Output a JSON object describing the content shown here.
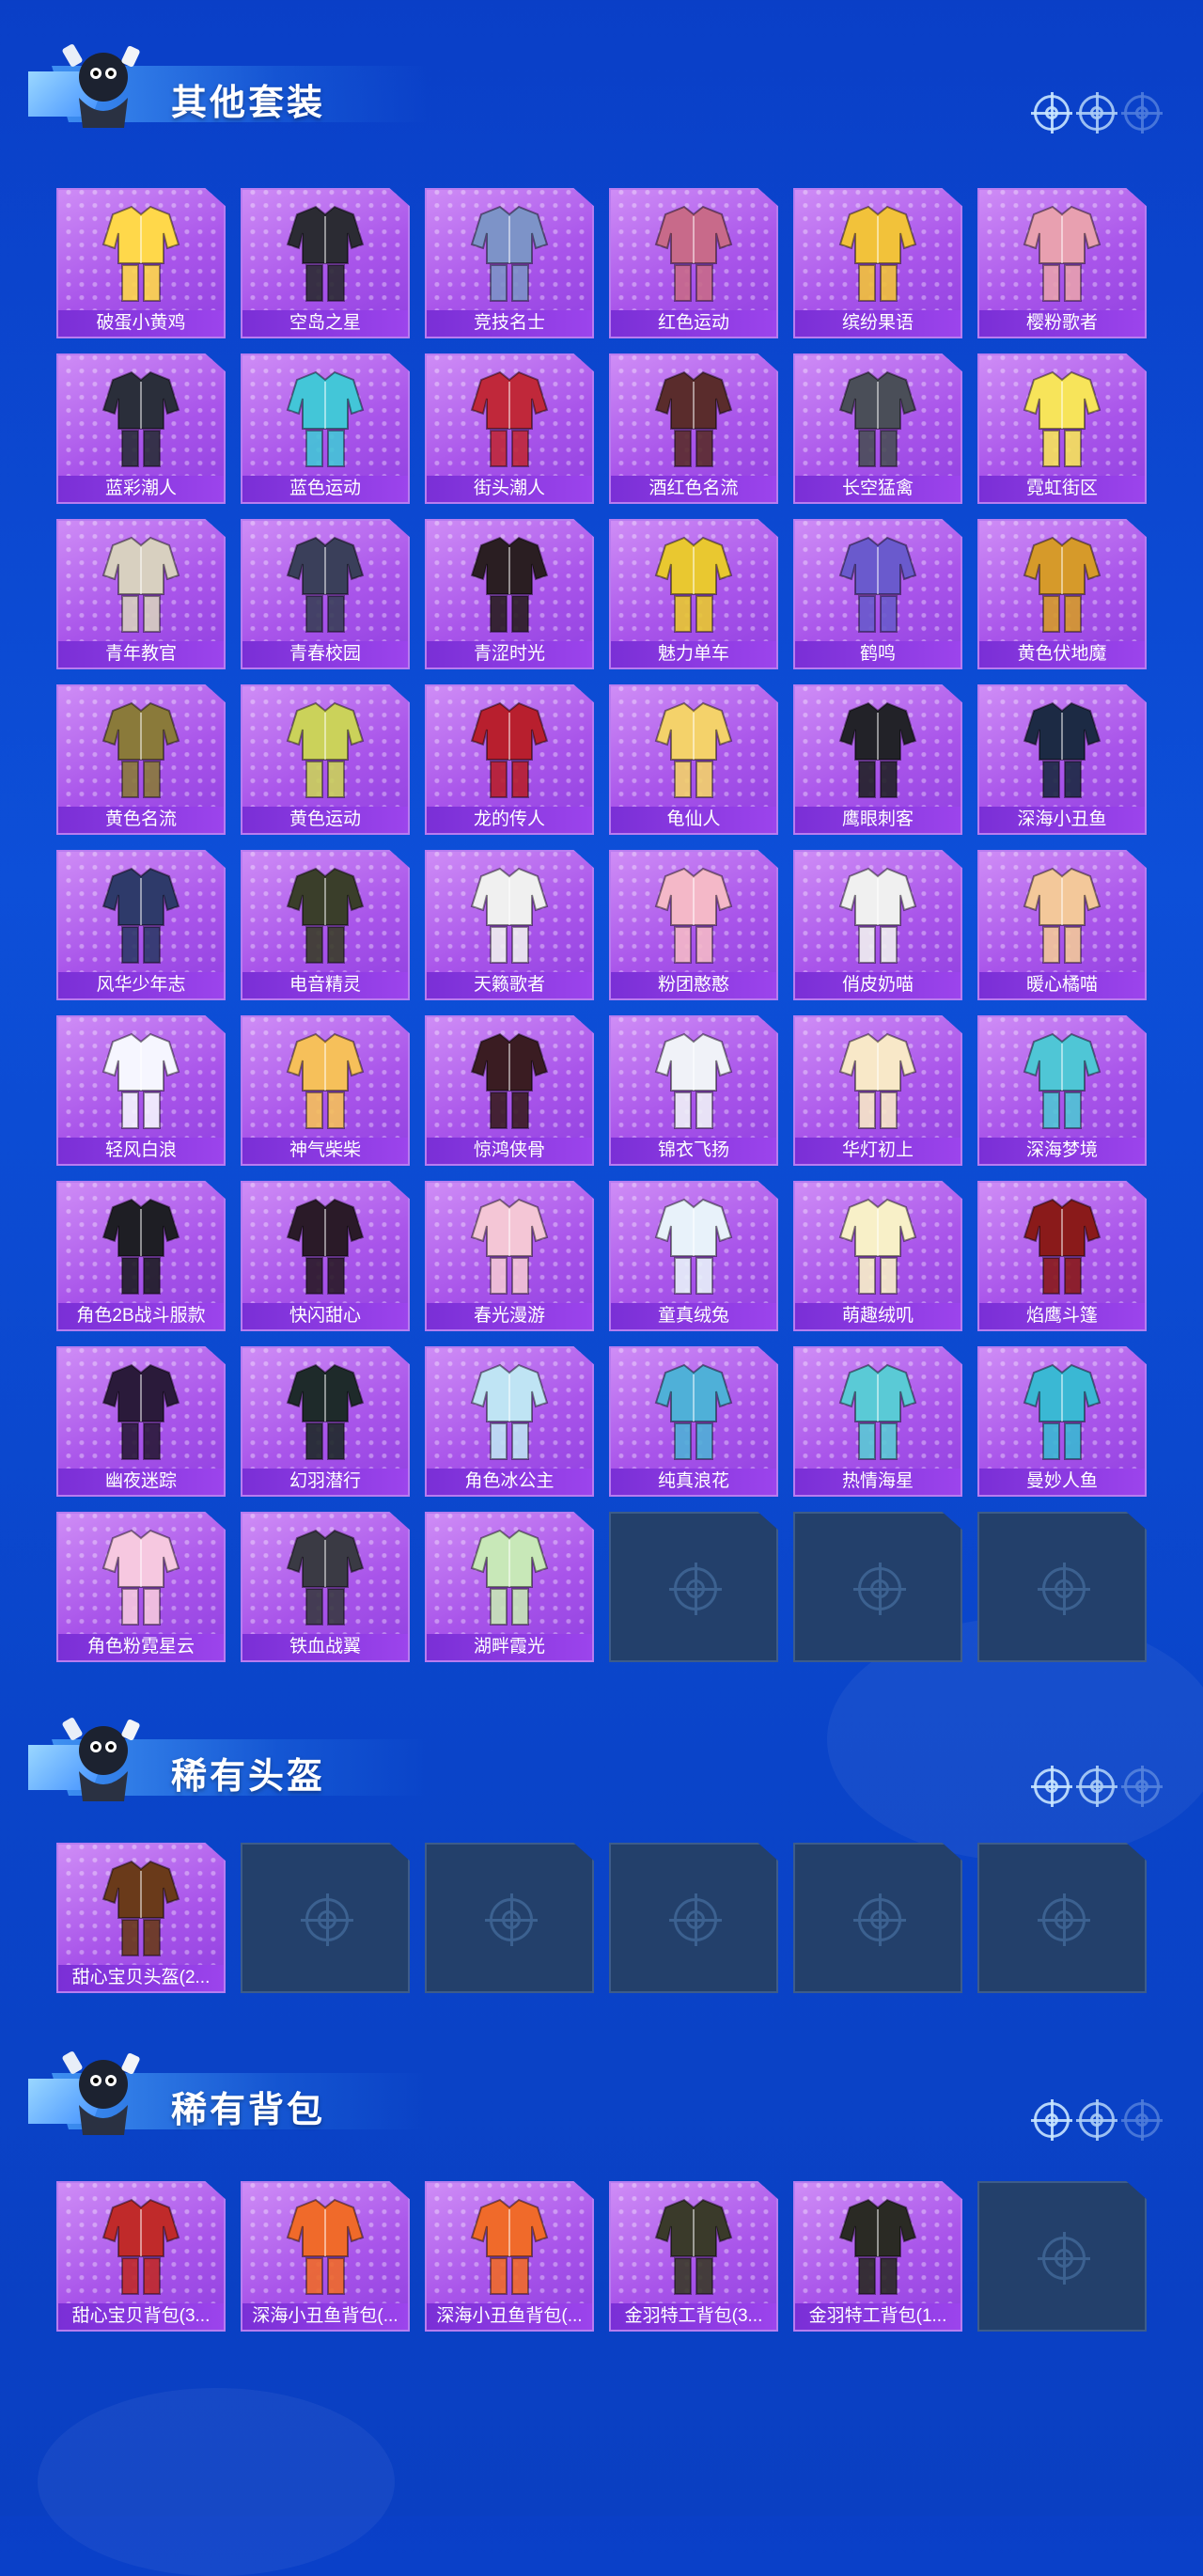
{
  "sections": [
    {
      "title": "其他套装",
      "items": [
        {
          "label": "破蛋小黄鸡",
          "icon": "chick-costume-icon",
          "color": "#ffd84a"
        },
        {
          "label": "空岛之星",
          "icon": "dark-suit-pair-icon",
          "color": "#2b2b33"
        },
        {
          "label": "竞技名士",
          "icon": "sport-jacket-icon",
          "color": "#7d93c8"
        },
        {
          "label": "红色运动",
          "icon": "pink-jacket-icon",
          "color": "#c86a8a"
        },
        {
          "label": "缤纷果语",
          "icon": "fruit-outfit-icon",
          "color": "#f2c23a"
        },
        {
          "label": "樱粉歌者",
          "icon": "pink-outfit-icon",
          "color": "#e8a0b0"
        },
        {
          "label": "蓝彩潮人",
          "icon": "black-puffer-icon",
          "color": "#2a2e3a"
        },
        {
          "label": "蓝色运动",
          "icon": "cyan-jacket-icon",
          "color": "#43c6d8"
        },
        {
          "label": "街头潮人",
          "icon": "red-puffer-icon",
          "color": "#c0283a"
        },
        {
          "label": "酒红色名流",
          "icon": "burgundy-suit-icon",
          "color": "#5a2c2c"
        },
        {
          "label": "长空猛禽",
          "icon": "camo-jacket-icon",
          "color": "#4a4e58"
        },
        {
          "label": "霓虹街区",
          "icon": "neon-outfit-icon",
          "color": "#f7e45a"
        },
        {
          "label": "青年教官",
          "icon": "instructor-suit-icon",
          "color": "#d8d0c0"
        },
        {
          "label": "青春校园",
          "icon": "school-uniform-icon",
          "color": "#3a3f5a"
        },
        {
          "label": "青涩时光",
          "icon": "black-red-uniform-icon",
          "color": "#2a1e22"
        },
        {
          "label": "魅力单车",
          "icon": "yellow-shirt-icon",
          "color": "#e9c830"
        },
        {
          "label": "鹤鸣",
          "icon": "purple-hoodie-icon",
          "color": "#6a5acd"
        },
        {
          "label": "黄色伏地魔",
          "icon": "yellow-hoodie-icon",
          "color": "#d69a2a"
        },
        {
          "label": "黄色名流",
          "icon": "khaki-suit-icon",
          "color": "#8a7a3a"
        },
        {
          "label": "黄色运动",
          "icon": "yellow-jacket-icon",
          "color": "#cbd25a"
        },
        {
          "label": "龙的传人",
          "icon": "red-dress-icon",
          "color": "#b81f2e"
        },
        {
          "label": "龟仙人",
          "icon": "hawaiian-shirt-icon",
          "color": "#f4d26a"
        },
        {
          "label": "鹰眼刺客",
          "icon": "black-coat-icon",
          "color": "#222228"
        },
        {
          "label": "深海小丑鱼",
          "icon": "diving-suit-icon",
          "color": "#1c2a44"
        },
        {
          "label": "风华少年志",
          "icon": "hanfu-blue-icon",
          "color": "#2e3a6a"
        },
        {
          "label": "电音精灵",
          "icon": "tech-armor-icon",
          "color": "#3a3e2a"
        },
        {
          "label": "天籁歌者",
          "icon": "white-suit-icon",
          "color": "#f0f0f0"
        },
        {
          "label": "粉团憨憨",
          "icon": "pink-pajama-icon",
          "color": "#f4b8c8"
        },
        {
          "label": "俏皮奶喵",
          "icon": "panda-outfit-icon",
          "color": "#f0f0f0"
        },
        {
          "label": "暖心橘喵",
          "icon": "orange-cat-outfit-icon",
          "color": "#f3c89a"
        },
        {
          "label": "轻风白浪",
          "icon": "white-lace-dress-icon",
          "color": "#f6f6ff"
        },
        {
          "label": "神气柴柴",
          "icon": "shiba-outfit-icon",
          "color": "#f6c05a"
        },
        {
          "label": "惊鸿侠骨",
          "icon": "black-hanfu-icon",
          "color": "#3a1c22"
        },
        {
          "label": "锦衣飞扬",
          "icon": "white-hanfu-icon",
          "color": "#f0f2f8"
        },
        {
          "label": "华灯初上",
          "icon": "cream-hanfu-icon",
          "color": "#f8e8c8"
        },
        {
          "label": "深海梦境",
          "icon": "sea-print-jacket-icon",
          "color": "#4fc6d6"
        },
        {
          "label": "角色2B战斗服款",
          "icon": "battle-dress-icon",
          "color": "#1e1e24"
        },
        {
          "label": "快闪甜心",
          "icon": "heart-jacket-icon",
          "color": "#2a1a28"
        },
        {
          "label": "春光漫游",
          "icon": "floral-jacket-icon",
          "color": "#f4c6d6"
        },
        {
          "label": "童真绒兔",
          "icon": "bunny-outfit-icon",
          "color": "#e8f2fa"
        },
        {
          "label": "萌趣绒叽",
          "icon": "chick-dress-icon",
          "color": "#f8f0c8"
        },
        {
          "label": "焰鹰斗篷",
          "icon": "flame-cloak-icon",
          "color": "#8a1a1a"
        },
        {
          "label": "幽夜迷踪",
          "icon": "shadow-armor-icon",
          "color": "#2a1a3a"
        },
        {
          "label": "幻羽潜行",
          "icon": "feather-armor-icon",
          "color": "#1e2a2a"
        },
        {
          "label": "角色冰公主",
          "icon": "ice-dress-icon",
          "color": "#bfe4f4"
        },
        {
          "label": "纯真浪花",
          "icon": "wave-swimsuit-icon",
          "color": "#4fb0d8"
        },
        {
          "label": "热情海星",
          "icon": "starfish-outfit-icon",
          "color": "#5acad6"
        },
        {
          "label": "曼妙人鱼",
          "icon": "mermaid-outfit-icon",
          "color": "#3ab8d4"
        },
        {
          "label": "角色粉霓星云",
          "icon": "pink-gown-icon",
          "color": "#f6c8e0"
        },
        {
          "label": "铁血战翼",
          "icon": "iron-armor-icon",
          "color": "#3a3a44"
        },
        {
          "label": "湖畔霞光",
          "icon": "green-hanfu-icon",
          "color": "#c8e8b8"
        }
      ],
      "empty_count": 3
    },
    {
      "title": "稀有头盔",
      "items": [
        {
          "label": "甜心宝贝头盔(2...",
          "icon": "bird-helmet-icon",
          "color": "#6a3a1a"
        }
      ],
      "empty_count": 5
    },
    {
      "title": "稀有背包",
      "items": [
        {
          "label": "甜心宝贝背包(3...",
          "icon": "cake-backpack-icon",
          "color": "#c02a2a"
        },
        {
          "label": "深海小丑鱼背包(...",
          "icon": "clownfish-backpack-icon",
          "color": "#f06a2a"
        },
        {
          "label": "深海小丑鱼背包(...",
          "icon": "clownfish-backpack-icon",
          "color": "#f06a2a"
        },
        {
          "label": "金羽特工背包(3...",
          "icon": "tactical-backpack-icon",
          "color": "#3a3a2a"
        },
        {
          "label": "金羽特工背包(1...",
          "icon": "tactical-backpack-icon",
          "color": "#2a2a24"
        }
      ],
      "empty_count": 1
    }
  ]
}
